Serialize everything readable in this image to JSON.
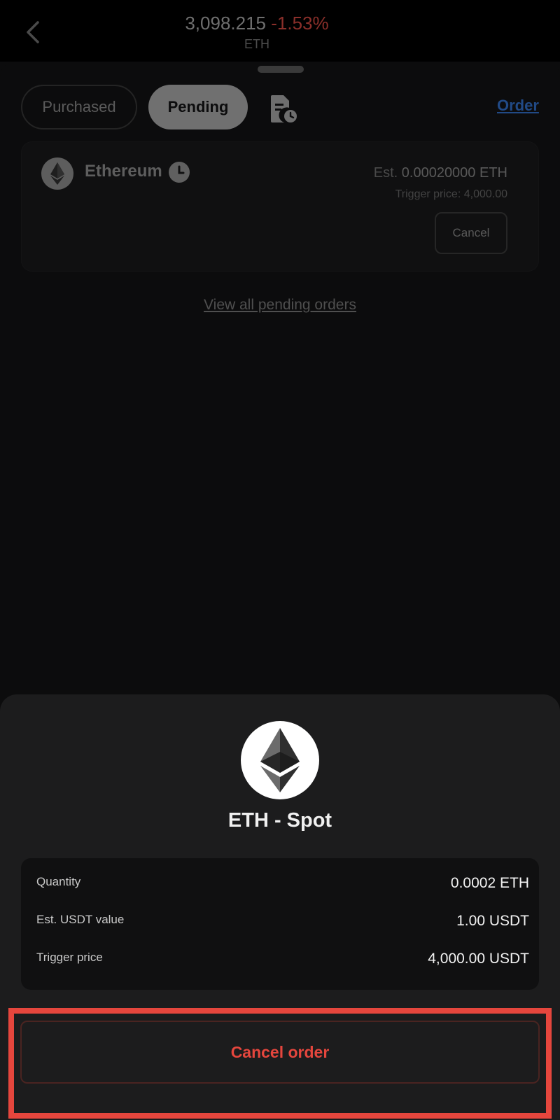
{
  "header": {
    "price": "3,098.215",
    "change": "-1.53%",
    "symbol": "ETH"
  },
  "tabs": {
    "purchased": "Purchased",
    "pending": "Pending",
    "active": "Pending"
  },
  "order_link": "Order",
  "pending_card": {
    "coin_name": "Ethereum",
    "est_label": "Est.",
    "est_value": "0.00020000 ETH",
    "trigger_label": "Trigger price:",
    "trigger_value": "4,000.00",
    "cancel_label": "Cancel"
  },
  "view_all": "View all pending orders",
  "modal": {
    "title": "ETH - Spot",
    "rows": [
      {
        "label": "Quantity",
        "value": "0.0002 ETH"
      },
      {
        "label": "Est. USDT value",
        "value": "1.00 USDT"
      },
      {
        "label": "Trigger price",
        "value": "4,000.00 USDT"
      }
    ],
    "cancel_order_label": "Cancel order"
  },
  "icons": {
    "back": "chevron-left-icon",
    "history": "document-clock-icon",
    "coin": "ethereum-icon",
    "pending_status": "clock-icon"
  },
  "colors": {
    "negative": "#e5463d",
    "link": "#2d6cd0",
    "highlight": "#e5463d"
  }
}
